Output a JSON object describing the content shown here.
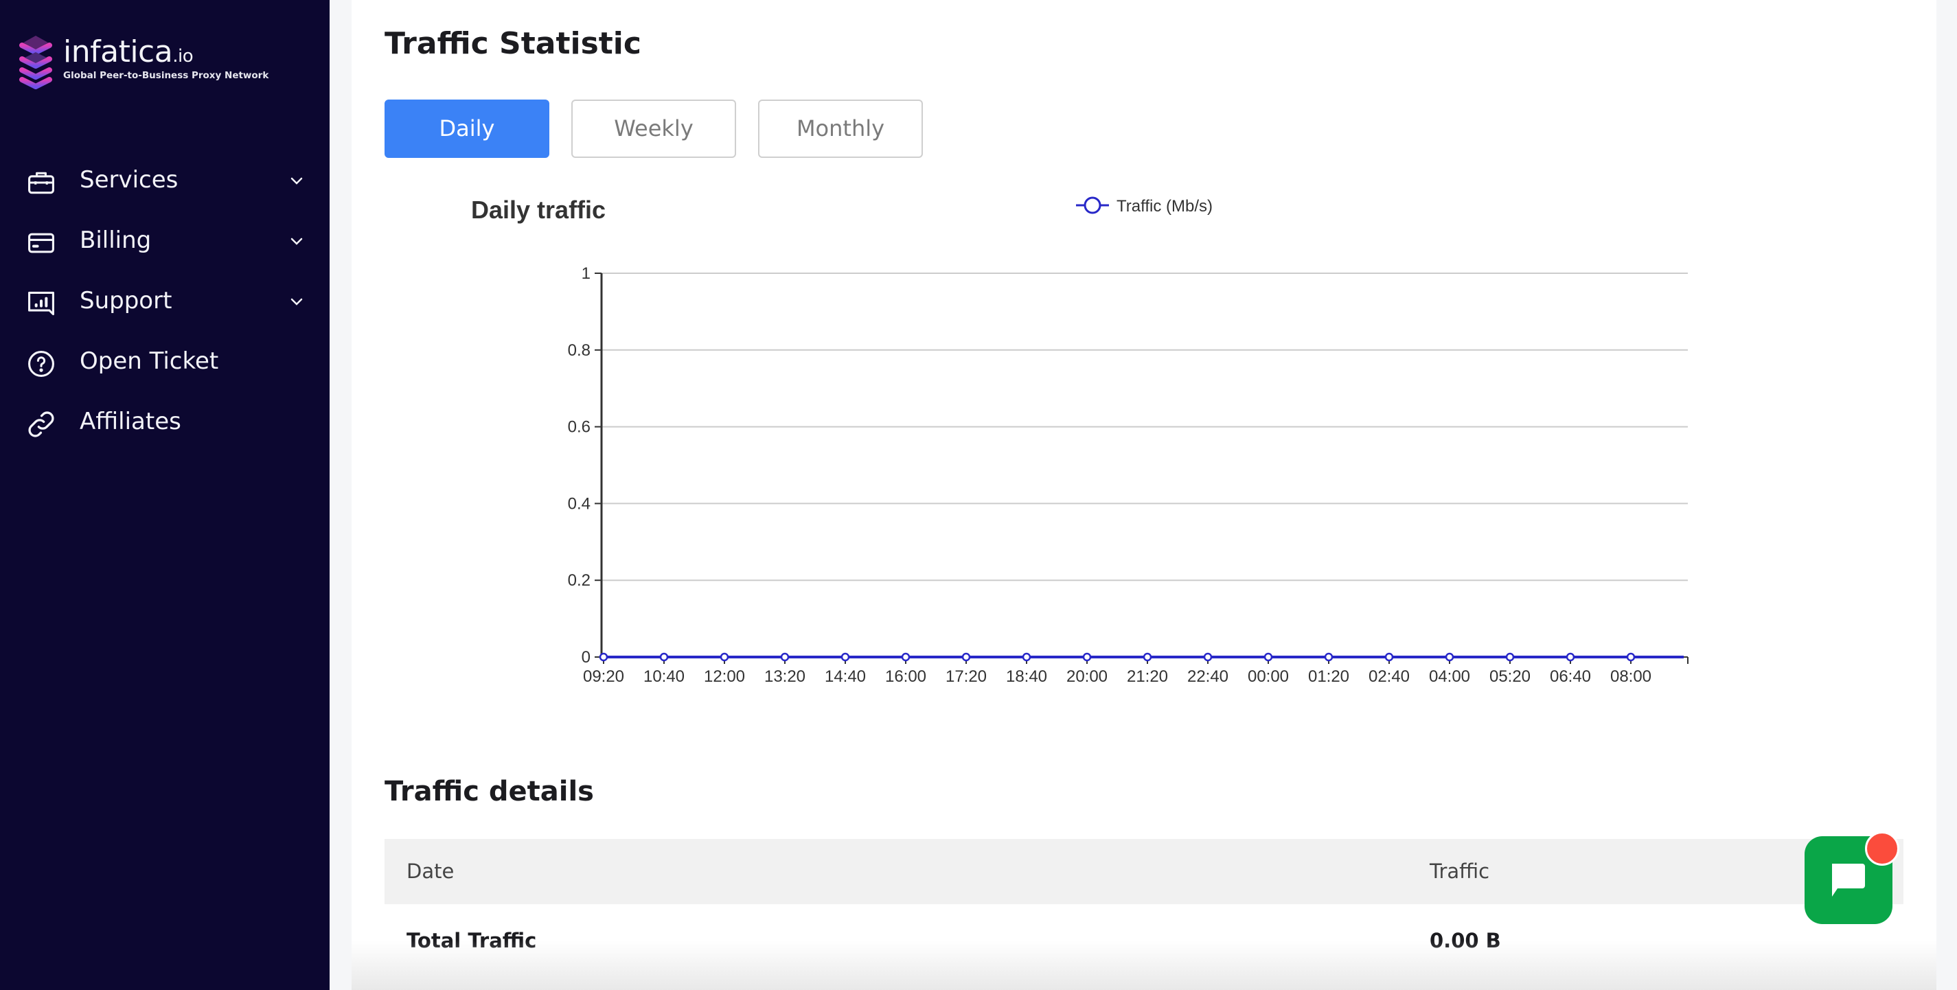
{
  "sidebar": {
    "brand": {
      "name": "infatica",
      "suffix": ".io",
      "tagline": "Global Peer-to-Business Proxy Network"
    },
    "items": [
      {
        "label": "Services",
        "icon": "briefcase-icon",
        "expandable": true
      },
      {
        "label": "Billing",
        "icon": "credit-card-icon",
        "expandable": true
      },
      {
        "label": "Support",
        "icon": "chart-message-icon",
        "expandable": true
      },
      {
        "label": "Open Ticket",
        "icon": "question-circle-icon",
        "expandable": false
      },
      {
        "label": "Affiliates",
        "icon": "link-icon",
        "expandable": false
      }
    ]
  },
  "main": {
    "title": "Traffic Statistic",
    "periods": [
      {
        "label": "Daily",
        "active": true
      },
      {
        "label": "Weekly",
        "active": false
      },
      {
        "label": "Monthly",
        "active": false
      }
    ],
    "details": {
      "title": "Traffic details",
      "columns": [
        "Date",
        "Traffic"
      ],
      "rows": [
        {
          "date": "Total Traffic",
          "traffic": "0.00 B"
        }
      ]
    }
  },
  "colors": {
    "sidebar_bg": "#0c0730",
    "accent": "#3b82f6",
    "series": "#2828c8",
    "chat": "#0aa648",
    "badge": "#fb4c3c"
  },
  "chat": {
    "icon": "chat-bubble-icon",
    "has_notification": true
  },
  "chart_data": {
    "type": "line",
    "title": "Daily traffic",
    "xlabel": "",
    "ylabel": "",
    "legend_position": "top-center",
    "grid": true,
    "ylim": [
      0,
      1
    ],
    "yticks": [
      "0",
      "0.2",
      "0.4",
      "0.6",
      "0.8",
      "1"
    ],
    "x": [
      "09:20",
      "10:40",
      "12:00",
      "13:20",
      "14:40",
      "16:00",
      "17:20",
      "18:40",
      "20:00",
      "21:20",
      "22:40",
      "00:00",
      "01:20",
      "02:40",
      "04:00",
      "05:20",
      "06:40",
      "08:00"
    ],
    "series": [
      {
        "name": "Traffic (Mb/s)",
        "values": [
          0,
          0,
          0,
          0,
          0,
          0,
          0,
          0,
          0,
          0,
          0,
          0,
          0,
          0,
          0,
          0,
          0,
          0
        ]
      }
    ]
  }
}
